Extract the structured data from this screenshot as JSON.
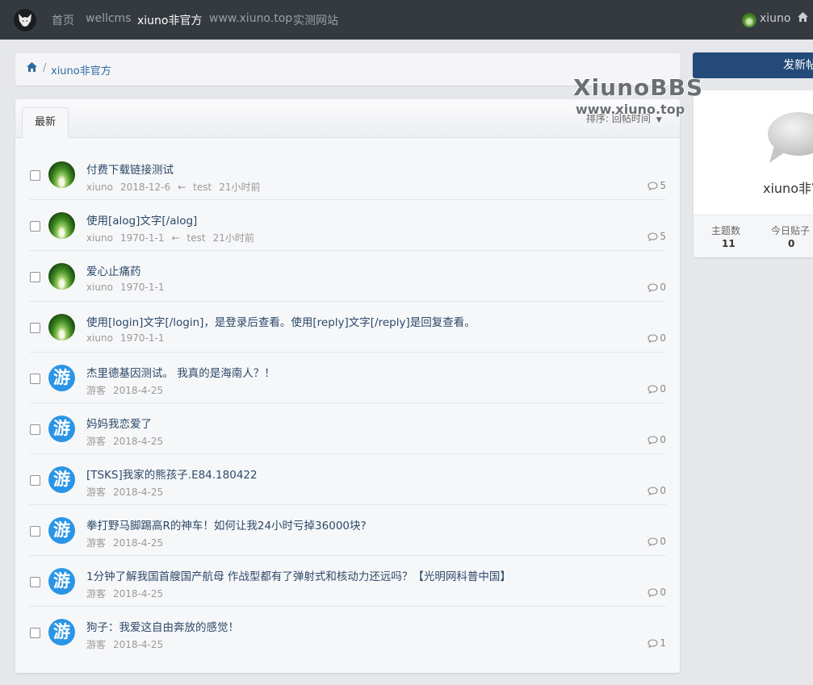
{
  "nav": {
    "logo_icon": "wolf-logo-icon",
    "links": [
      "首页",
      "wellcms",
      "xiuno非官方",
      "www.xiuno.top",
      "实测网站"
    ],
    "active_index": 2,
    "user": "xiuno"
  },
  "breadcrumb": {
    "home_icon": "home-icon",
    "separator": "/",
    "current": "xiuno非官方"
  },
  "tabs": {
    "latest": "最新"
  },
  "sort": {
    "label": "排序:",
    "value": "回帖时间"
  },
  "threads": [
    {
      "title": "付费下载链接测试",
      "author": "xiuno",
      "date": "2018-12-6",
      "last_user": "test",
      "last_time": "21小时前",
      "replies": "5",
      "avatar": "photo"
    },
    {
      "title": "使用[alog]文字[/alog]",
      "author": "xiuno",
      "date": "1970-1-1",
      "last_user": "test",
      "last_time": "21小时前",
      "replies": "5",
      "avatar": "photo"
    },
    {
      "title": "爱心止痛药",
      "author": "xiuno",
      "date": "1970-1-1",
      "replies": "0",
      "avatar": "photo"
    },
    {
      "title": "使用[login]文字[/login]，是登录后查看。使用[reply]文字[/reply]是回复查看。",
      "author": "xiuno",
      "date": "1970-1-1",
      "replies": "0",
      "avatar": "photo"
    },
    {
      "title": "杰里德基因测试。 我真的是海南人？！",
      "author": "游客",
      "date": "2018-4-25",
      "replies": "0",
      "avatar": "guest"
    },
    {
      "title": "妈妈我恋爱了",
      "author": "游客",
      "date": "2018-4-25",
      "replies": "0",
      "avatar": "guest"
    },
    {
      "title": "[TSKS]我家的熊孩子.E84.180422",
      "author": "游客",
      "date": "2018-4-25",
      "replies": "0",
      "avatar": "guest"
    },
    {
      "title": "拳打野马脚踢高R的神车！如何让我24小时亏掉36000块?",
      "author": "游客",
      "date": "2018-4-25",
      "replies": "0",
      "avatar": "guest"
    },
    {
      "title": "1分钟了解我国首艘国产航母 作战型都有了弹射式和核动力还远吗？【光明网科普中国】",
      "author": "游客",
      "date": "2018-4-25",
      "replies": "0",
      "avatar": "guest"
    },
    {
      "title": "狗子：我爱这自由奔放的感觉！",
      "author": "游客",
      "date": "2018-4-25",
      "replies": "1",
      "avatar": "guest"
    }
  ],
  "guest_avatar_char": "游",
  "reply_arrow": "←",
  "sidebar": {
    "post_button": "发新帖",
    "forum_name": "xiuno非官方",
    "stats": [
      {
        "label": "主题数",
        "value": "11"
      },
      {
        "label": "今日贴子",
        "value": "0"
      }
    ]
  },
  "watermark": {
    "title": "XiunoBBS",
    "url": "www.xiuno.top"
  },
  "colors": {
    "navbar": "#343a40",
    "accent": "#234a78",
    "link": "#2c4968",
    "guest_avatar": "#2a95e6"
  }
}
